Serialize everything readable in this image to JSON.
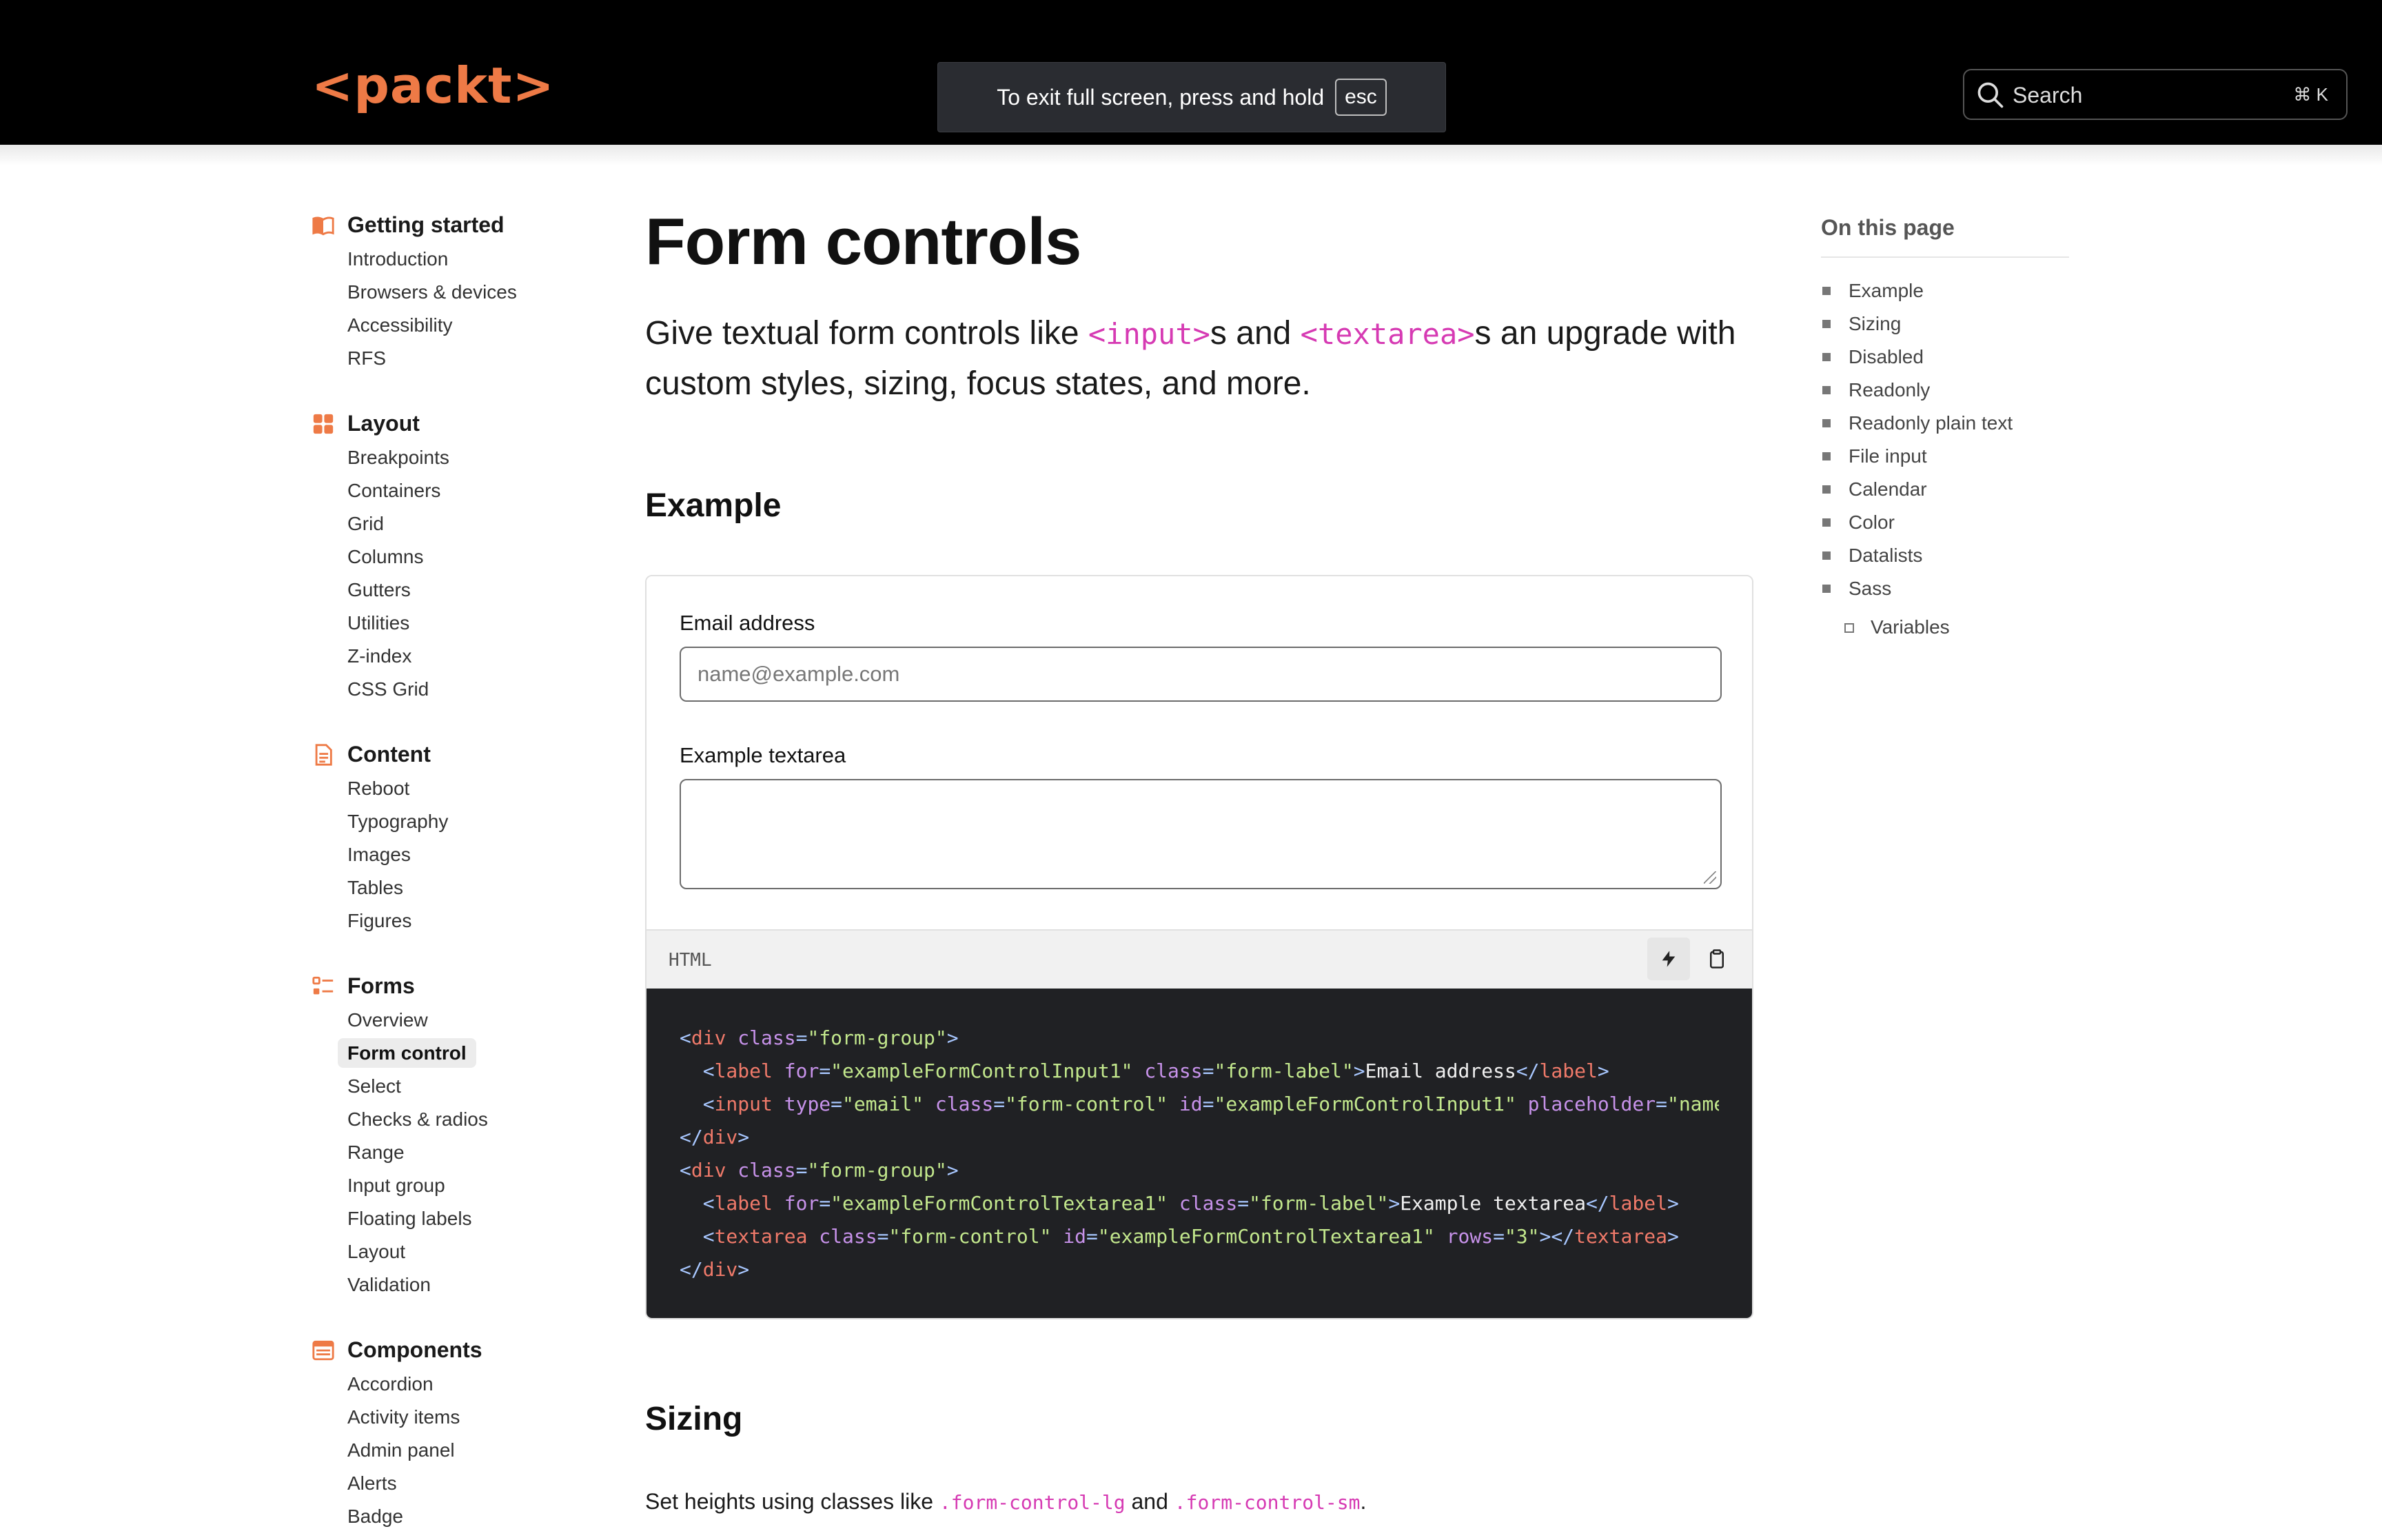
{
  "header": {
    "logo": "<packt>",
    "fullscreen_notice": "To exit full screen, press and hold",
    "fullscreen_key": "esc",
    "search_label": "Search",
    "search_shortcut": "⌘ K"
  },
  "sidebar": {
    "groups": [
      {
        "title": "Getting started",
        "icon": "book-icon",
        "items": [
          "Introduction",
          "Browsers & devices",
          "Accessibility",
          "RFS"
        ]
      },
      {
        "title": "Layout",
        "icon": "grid-icon",
        "items": [
          "Breakpoints",
          "Containers",
          "Grid",
          "Columns",
          "Gutters",
          "Utilities",
          "Z-index",
          "CSS Grid"
        ]
      },
      {
        "title": "Content",
        "icon": "document-icon",
        "items": [
          "Reboot",
          "Typography",
          "Images",
          "Tables",
          "Figures"
        ]
      },
      {
        "title": "Forms",
        "icon": "checklist-icon",
        "items": [
          "Overview",
          "Form control",
          "Select",
          "Checks & radios",
          "Range",
          "Input group",
          "Floating labels",
          "Layout",
          "Validation"
        ],
        "active": "Form control"
      },
      {
        "title": "Components",
        "icon": "components-icon",
        "items": [
          "Accordion",
          "Activity items",
          "Admin panel",
          "Alerts",
          "Badge"
        ]
      }
    ]
  },
  "main": {
    "title": "Form controls",
    "lead_1": "Give textual form controls like ",
    "lead_code_1": "<input>",
    "lead_2": "s and ",
    "lead_code_2": "<textarea>",
    "lead_3": "s an upgrade with custom styles, sizing, focus states, and more.",
    "example_heading": "Example",
    "email_label": "Email address",
    "email_placeholder": "name@example.com",
    "textarea_label": "Example textarea",
    "code_lang": "HTML",
    "sizing_heading": "Sizing",
    "sizing_text_1": "Set heights using classes like ",
    "sizing_code_1": ".form-control-lg",
    "sizing_text_2": " and ",
    "sizing_code_2": ".form-control-sm",
    "sizing_text_3": "."
  },
  "code": {
    "l1_open": "<",
    "l1_tag": "div",
    "l1_attr": " class",
    "l1_eq": "=",
    "l1_val": "\"form-group\"",
    "l1_close": ">",
    "l2_indent": "  ",
    "l2_tag": "label",
    "l2_attr1": " for",
    "l2_val1": "\"exampleFormControlInput1\"",
    "l2_attr2": " class",
    "l2_val2": "\"form-label\"",
    "l2_text": "Email address",
    "l2_end": "</",
    "l3_tag": "input",
    "l3_attr1": " type",
    "l3_val1": "\"email\"",
    "l3_attr2": " class",
    "l3_val2": "\"form-control\"",
    "l3_attr3": " id",
    "l3_val3": "\"exampleFormControlInput1\"",
    "l3_attr4": " placeholder",
    "l3_val4": "\"name@example.com\"",
    "l3_tail": ">",
    "l5_val": "\"form-group\"",
    "l6_attr1": " for",
    "l6_val1": "\"exampleFormControlTextarea1\"",
    "l6_val2": "\"form-label\"",
    "l6_text": "Example textarea",
    "l7_tag": "textarea",
    "l7_val1": "\"form-control\"",
    "l7_val2": "\"exampleFormControlTextarea1\"",
    "l7_attr3": " rows",
    "l7_val3": "\"3\""
  },
  "toc": {
    "title": "On this page",
    "items": [
      "Example",
      "Sizing",
      "Disabled",
      "Readonly",
      "Readonly plain text",
      "File input",
      "Calendar",
      "Color",
      "Datalists",
      "Sass"
    ],
    "sub_items": [
      "Variables"
    ]
  },
  "colors": {
    "brand_orange": "#ee7a46",
    "code_pink": "#d63ab3",
    "topbar_bg": "#000000",
    "code_bg": "#202124"
  }
}
